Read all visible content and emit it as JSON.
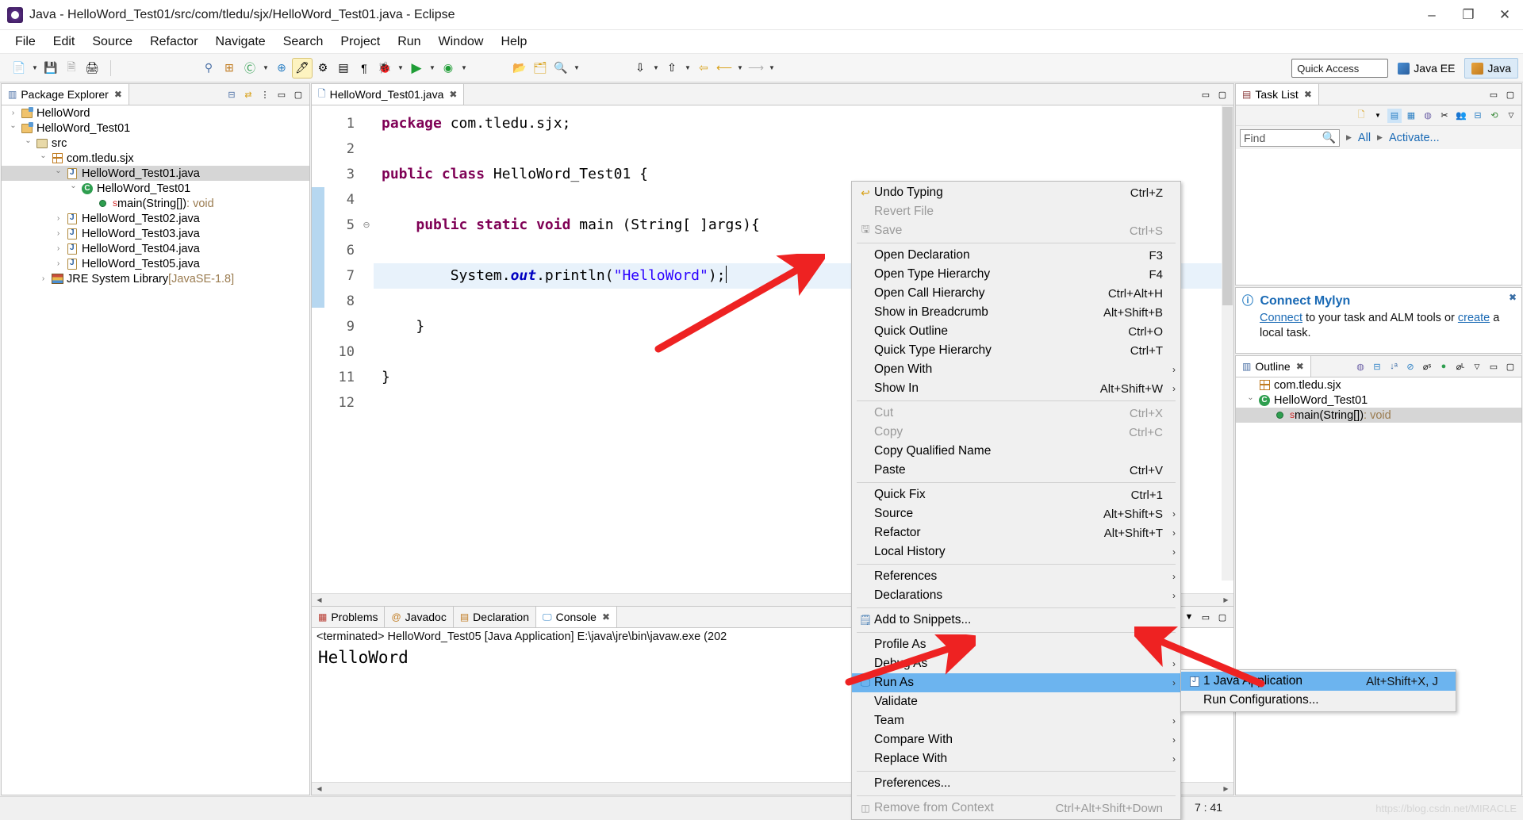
{
  "window": {
    "title": "Java - HelloWord_Test01/src/com/tledu/sjx/HelloWord_Test01.java - Eclipse",
    "minimize": "–",
    "maximize": "❐",
    "close": "✕"
  },
  "menubar": [
    "File",
    "Edit",
    "Source",
    "Refactor",
    "Navigate",
    "Search",
    "Project",
    "Run",
    "Window",
    "Help"
  ],
  "toolbar": {
    "quick_access": "Quick Access",
    "perspectives": [
      {
        "label": "Java EE",
        "active": false
      },
      {
        "label": "Java",
        "active": true
      }
    ]
  },
  "package_explorer": {
    "tab": "Package Explorer",
    "close": "✖",
    "tree": [
      {
        "label": "HelloWord",
        "indent": 0,
        "arrow": "right",
        "icon": "project",
        "selected": false,
        "suffix": ""
      },
      {
        "label": "HelloWord_Test01",
        "indent": 0,
        "arrow": "down",
        "icon": "project",
        "selected": false,
        "suffix": ""
      },
      {
        "label": "src",
        "indent": 1,
        "arrow": "down",
        "icon": "src",
        "selected": false,
        "suffix": ""
      },
      {
        "label": "com.tledu.sjx",
        "indent": 2,
        "arrow": "down",
        "icon": "package",
        "selected": false,
        "suffix": ""
      },
      {
        "label": "HelloWord_Test01.java",
        "indent": 3,
        "arrow": "down",
        "icon": "java",
        "selected": true,
        "suffix": ""
      },
      {
        "label": "HelloWord_Test01",
        "indent": 4,
        "arrow": "down",
        "icon": "class",
        "selected": false,
        "suffix": ""
      },
      {
        "label": "main(String[])",
        "indent": 5,
        "arrow": "none",
        "icon": "method",
        "selected": false,
        "suffix": " : void"
      },
      {
        "label": "HelloWord_Test02.java",
        "indent": 3,
        "arrow": "right",
        "icon": "java",
        "selected": false,
        "suffix": ""
      },
      {
        "label": "HelloWord_Test03.java",
        "indent": 3,
        "arrow": "right",
        "icon": "java",
        "selected": false,
        "suffix": ""
      },
      {
        "label": "HelloWord_Test04.java",
        "indent": 3,
        "arrow": "right",
        "icon": "java",
        "selected": false,
        "suffix": ""
      },
      {
        "label": "HelloWord_Test05.java",
        "indent": 3,
        "arrow": "right",
        "icon": "java",
        "selected": false,
        "suffix": ""
      },
      {
        "label": "JRE System Library",
        "indent": 2,
        "arrow": "right",
        "icon": "jre",
        "selected": false,
        "suffix": " [JavaSE-1.8]"
      }
    ]
  },
  "editor": {
    "tab": "HelloWord_Test01.java",
    "close": "✖",
    "line_numbers": [
      "1",
      "2",
      "3",
      "4",
      "5",
      "6",
      "7",
      "8",
      "9",
      "10",
      "11",
      "12"
    ],
    "fold_line": 5,
    "highlight_line": 7,
    "lines": [
      [
        {
          "t": "package ",
          "c": "kw"
        },
        {
          "t": "com.tledu.sjx;",
          "c": ""
        }
      ],
      [],
      [
        {
          "t": "public class ",
          "c": "kw"
        },
        {
          "t": "HelloWord_Test01 {",
          "c": ""
        }
      ],
      [],
      [
        {
          "t": "    ",
          "c": ""
        },
        {
          "t": "public static void ",
          "c": "kw"
        },
        {
          "t": "main (String[ ]args){",
          "c": ""
        }
      ],
      [],
      [
        {
          "t": "        System.",
          "c": ""
        },
        {
          "t": "out",
          "c": "fld"
        },
        {
          "t": ".println(",
          "c": ""
        },
        {
          "t": "\"HelloWord\"",
          "c": "str"
        },
        {
          "t": ");",
          "c": ""
        }
      ],
      [],
      [
        {
          "t": "    }",
          "c": ""
        }
      ],
      [],
      [
        {
          "t": "}",
          "c": ""
        }
      ],
      []
    ]
  },
  "console": {
    "tabs": [
      {
        "label": "Problems",
        "icon": "problems-icon",
        "active": false
      },
      {
        "label": "Javadoc",
        "icon": "javadoc-icon",
        "active": false
      },
      {
        "label": "Declaration",
        "icon": "declaration-icon",
        "active": false
      },
      {
        "label": "Console",
        "icon": "console-icon",
        "active": true
      }
    ],
    "close": "✖",
    "header": "<terminated> HelloWord_Test05 [Java Application] E:\\java\\jre\\bin\\javaw.exe (202",
    "output": "HelloWord"
  },
  "task_list": {
    "tab": "Task List",
    "close": "✖",
    "find_placeholder": "Find",
    "filter_all": "All",
    "activate": "Activate..."
  },
  "mylyn": {
    "title": "Connect Mylyn",
    "link1": "Connect",
    "text1": " to your task and ALM tools or ",
    "link2": "create",
    "text2": " a local task.",
    "close": "✖"
  },
  "outline": {
    "tab": "Outline",
    "close": "✖",
    "tree": [
      {
        "label": "com.tledu.sjx",
        "indent": 0,
        "arrow": "none",
        "icon": "package",
        "selected": false,
        "suffix": ""
      },
      {
        "label": "HelloWord_Test01",
        "indent": 0,
        "arrow": "down",
        "icon": "class",
        "selected": false,
        "suffix": ""
      },
      {
        "label": "main(String[])",
        "indent": 1,
        "arrow": "none",
        "icon": "method",
        "selected": true,
        "suffix": " : void"
      }
    ]
  },
  "context_menu": {
    "items": [
      {
        "label": "Undo Typing",
        "key": "Ctrl+Z",
        "icon": "undo-icon",
        "disabled": false,
        "submenu": false
      },
      {
        "label": "Revert File",
        "key": "",
        "icon": "",
        "disabled": true,
        "submenu": false
      },
      {
        "label": "Save",
        "key": "Ctrl+S",
        "icon": "save-icon",
        "disabled": true,
        "submenu": false
      },
      {
        "sep": true
      },
      {
        "label": "Open Declaration",
        "key": "F3",
        "icon": "",
        "disabled": false,
        "submenu": false
      },
      {
        "label": "Open Type Hierarchy",
        "key": "F4",
        "icon": "",
        "disabled": false,
        "submenu": false
      },
      {
        "label": "Open Call Hierarchy",
        "key": "Ctrl+Alt+H",
        "icon": "",
        "disabled": false,
        "submenu": false
      },
      {
        "label": "Show in Breadcrumb",
        "key": "Alt+Shift+B",
        "icon": "",
        "disabled": false,
        "submenu": false
      },
      {
        "label": "Quick Outline",
        "key": "Ctrl+O",
        "icon": "",
        "disabled": false,
        "submenu": false
      },
      {
        "label": "Quick Type Hierarchy",
        "key": "Ctrl+T",
        "icon": "",
        "disabled": false,
        "submenu": false
      },
      {
        "label": "Open With",
        "key": "",
        "icon": "",
        "disabled": false,
        "submenu": true
      },
      {
        "label": "Show In",
        "key": "Alt+Shift+W",
        "icon": "",
        "disabled": false,
        "submenu": true
      },
      {
        "sep": true
      },
      {
        "label": "Cut",
        "key": "Ctrl+X",
        "icon": "",
        "disabled": true,
        "submenu": false
      },
      {
        "label": "Copy",
        "key": "Ctrl+C",
        "icon": "",
        "disabled": true,
        "submenu": false
      },
      {
        "label": "Copy Qualified Name",
        "key": "",
        "icon": "",
        "disabled": false,
        "submenu": false
      },
      {
        "label": "Paste",
        "key": "Ctrl+V",
        "icon": "",
        "disabled": false,
        "submenu": false
      },
      {
        "sep": true
      },
      {
        "label": "Quick Fix",
        "key": "Ctrl+1",
        "icon": "",
        "disabled": false,
        "submenu": false
      },
      {
        "label": "Source",
        "key": "Alt+Shift+S",
        "icon": "",
        "disabled": false,
        "submenu": true
      },
      {
        "label": "Refactor",
        "key": "Alt+Shift+T",
        "icon": "",
        "disabled": false,
        "submenu": true
      },
      {
        "label": "Local History",
        "key": "",
        "icon": "",
        "disabled": false,
        "submenu": true
      },
      {
        "sep": true
      },
      {
        "label": "References",
        "key": "",
        "icon": "",
        "disabled": false,
        "submenu": true
      },
      {
        "label": "Declarations",
        "key": "",
        "icon": "",
        "disabled": false,
        "submenu": true
      },
      {
        "sep": true
      },
      {
        "label": "Add to Snippets...",
        "key": "",
        "icon": "snippet-icon",
        "disabled": false,
        "submenu": false
      },
      {
        "sep": true
      },
      {
        "label": "Profile As",
        "key": "",
        "icon": "",
        "disabled": false,
        "submenu": true
      },
      {
        "label": "Debug As",
        "key": "",
        "icon": "",
        "disabled": false,
        "submenu": true
      },
      {
        "label": "Run As",
        "key": "",
        "icon": "run-icon",
        "disabled": false,
        "submenu": true,
        "highlighted": true
      },
      {
        "label": "Validate",
        "key": "",
        "icon": "",
        "disabled": false,
        "submenu": false
      },
      {
        "label": "Team",
        "key": "",
        "icon": "",
        "disabled": false,
        "submenu": true
      },
      {
        "label": "Compare With",
        "key": "",
        "icon": "",
        "disabled": false,
        "submenu": true
      },
      {
        "label": "Replace With",
        "key": "",
        "icon": "",
        "disabled": false,
        "submenu": true
      },
      {
        "sep": true
      },
      {
        "label": "Preferences...",
        "key": "",
        "icon": "",
        "disabled": false,
        "submenu": false
      },
      {
        "sep": true
      },
      {
        "label": "Remove from Context",
        "key": "Ctrl+Alt+Shift+Down",
        "icon": "remove-icon",
        "disabled": true,
        "submenu": false
      }
    ]
  },
  "run_as_submenu": {
    "items": [
      {
        "label": "1 Java Application",
        "key": "Alt+Shift+X, J",
        "icon": "java-app-icon",
        "highlighted": true
      },
      {
        "label": "Run Configurations...",
        "key": "",
        "icon": "",
        "highlighted": false
      }
    ]
  },
  "status_bar": {
    "position": "7 : 41",
    "watermark": "https://blog.csdn.net/MIRACLE"
  },
  "colors": {
    "accent": "#6cb4ef",
    "link": "#1a6ab5",
    "keyword": "#7f0055",
    "string": "#2a00ff",
    "field": "#0000c0",
    "annotation_arrow": "#ee2222"
  }
}
